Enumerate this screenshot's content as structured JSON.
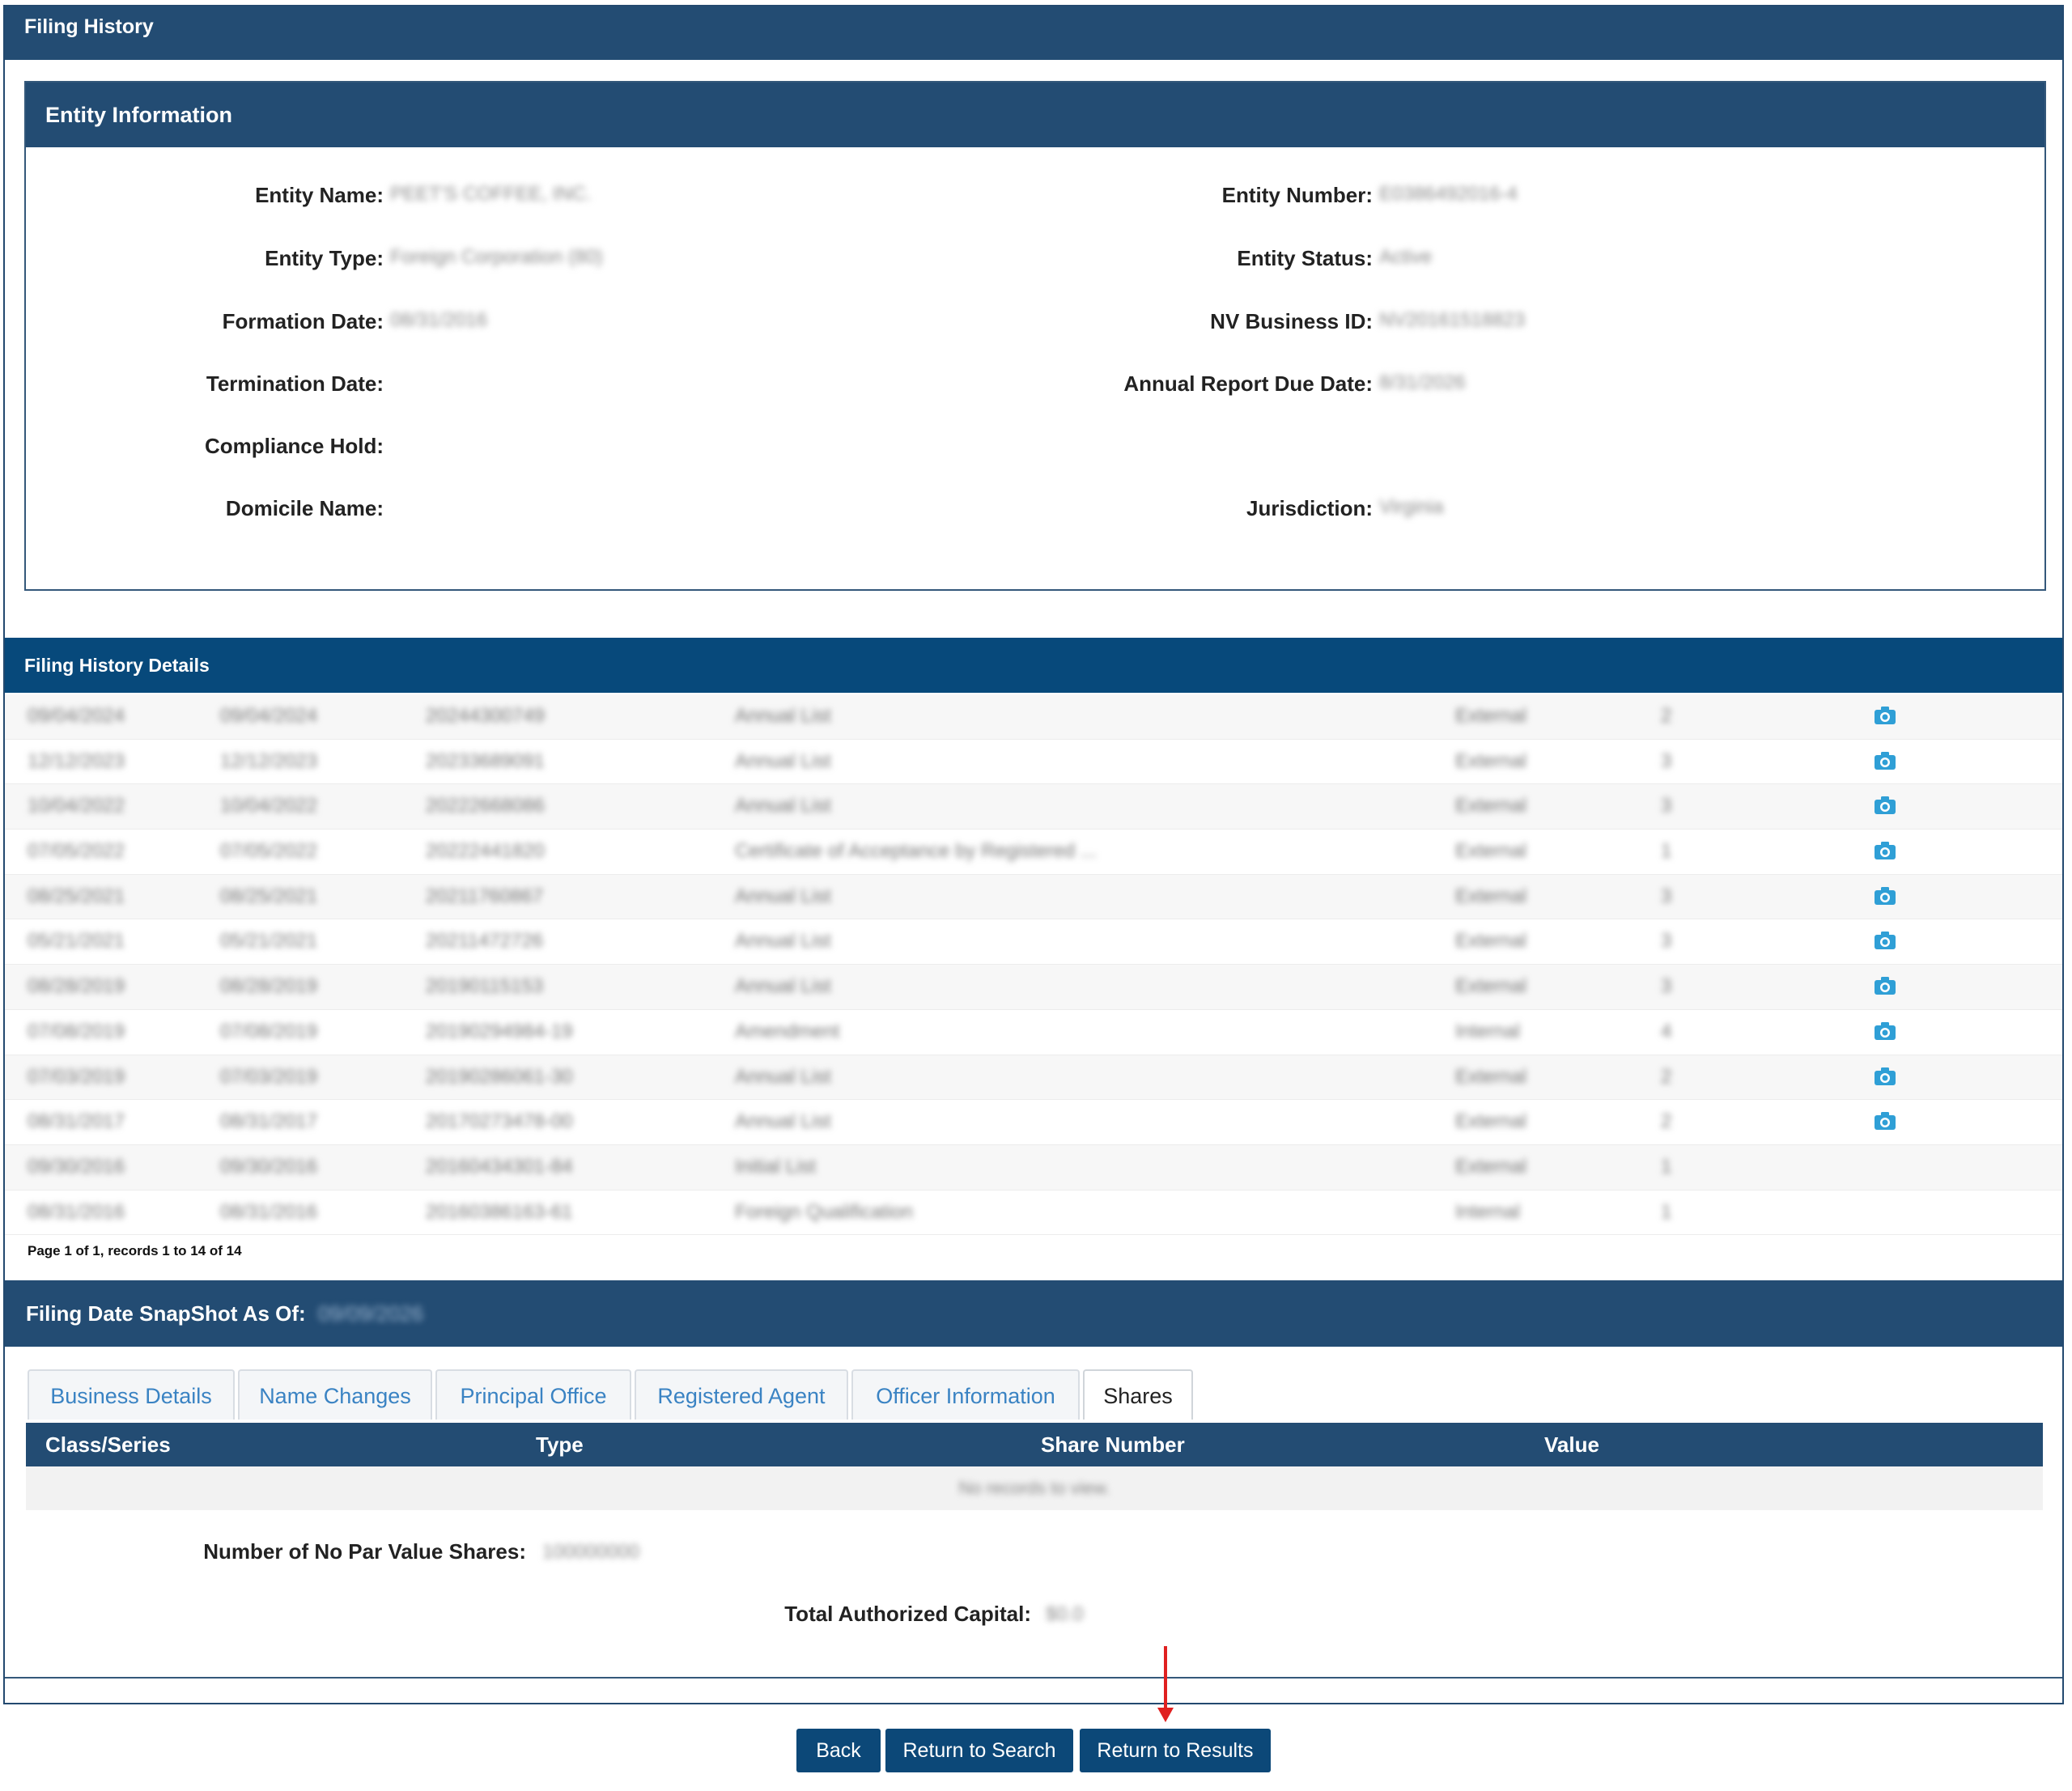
{
  "page_title": "Filing History",
  "entity": {
    "header": "Entity Information",
    "labels": {
      "entity_name": "Entity Name:",
      "entity_type": "Entity Type:",
      "formation_date": "Formation Date:",
      "termination_date": "Termination Date:",
      "compliance_hold": "Compliance Hold:",
      "domicile_name": "Domicile Name:",
      "entity_number": "Entity Number:",
      "entity_status": "Entity Status:",
      "nv_business_id": "NV Business ID:",
      "annual_report_due": "Annual Report Due Date:",
      "jurisdiction": "Jurisdiction:"
    },
    "values": {
      "entity_name": "PEET'S COFFEE, INC.",
      "entity_type": "Foreign Corporation (80)",
      "formation_date": "08/31/2016",
      "entity_number": "E0386492016-4",
      "entity_status": "Active",
      "nv_business_id": "NV20161518823",
      "annual_report_due": "8/31/2026",
      "jurisdiction": "Virginia"
    }
  },
  "filing_history": {
    "header": "Filing History Details",
    "rows": [
      {
        "filed": "09/04/2024",
        "effective": "09/04/2024",
        "number": "20244300749",
        "type": "Annual List",
        "source": "External",
        "pages": "2",
        "has_image": true
      },
      {
        "filed": "12/12/2023",
        "effective": "12/12/2023",
        "number": "20233689091",
        "type": "Annual List",
        "source": "External",
        "pages": "3",
        "has_image": true
      },
      {
        "filed": "10/04/2022",
        "effective": "10/04/2022",
        "number": "20222668086",
        "type": "Annual List",
        "source": "External",
        "pages": "3",
        "has_image": true
      },
      {
        "filed": "07/05/2022",
        "effective": "07/05/2022",
        "number": "20222441820",
        "type": "Certificate of Acceptance by Registered ...",
        "source": "External",
        "pages": "1",
        "has_image": true
      },
      {
        "filed": "08/25/2021",
        "effective": "08/25/2021",
        "number": "20211760867",
        "type": "Annual List",
        "source": "External",
        "pages": "3",
        "has_image": true
      },
      {
        "filed": "05/21/2021",
        "effective": "05/21/2021",
        "number": "20211472726",
        "type": "Annual List",
        "source": "External",
        "pages": "3",
        "has_image": true
      },
      {
        "filed": "08/28/2019",
        "effective": "08/28/2019",
        "number": "20190115153",
        "type": "Annual List",
        "source": "External",
        "pages": "3",
        "has_image": true
      },
      {
        "filed": "07/08/2019",
        "effective": "07/08/2019",
        "number": "20190294984-19",
        "type": "Amendment",
        "source": "Internal",
        "pages": "4",
        "has_image": true
      },
      {
        "filed": "07/03/2019",
        "effective": "07/03/2019",
        "number": "20190286061-30",
        "type": "Annual List",
        "source": "External",
        "pages": "2",
        "has_image": true
      },
      {
        "filed": "08/31/2017",
        "effective": "08/31/2017",
        "number": "20170273478-00",
        "type": "Annual List",
        "source": "External",
        "pages": "2",
        "has_image": true
      },
      {
        "filed": "09/30/2016",
        "effective": "09/30/2016",
        "number": "20160434301-84",
        "type": "Initial List",
        "source": "External",
        "pages": "1",
        "has_image": false
      },
      {
        "filed": "08/31/2016",
        "effective": "08/31/2016",
        "number": "20160386163-61",
        "type": "Foreign Qualification",
        "source": "Internal",
        "pages": "1",
        "has_image": false
      }
    ],
    "pager": "Page 1 of 1, records 1 to 14 of 14"
  },
  "snapshot": {
    "label": "Filing Date SnapShot As Of:",
    "date": "09/09/2026",
    "tabs": [
      "Business Details",
      "Name Changes",
      "Principal Office",
      "Registered Agent",
      "Officer Information",
      "Shares"
    ],
    "active_tab": "Shares",
    "shares_columns": [
      "Class/Series",
      "Type",
      "Share Number",
      "Value"
    ],
    "empty_message": "No records to view.",
    "no_par_label": "Number of No Par Value Shares:",
    "no_par_value": "100000000",
    "capital_label": "Total Authorized Capital:",
    "capital_value": "$0.0"
  },
  "buttons": {
    "back": "Back",
    "return_search": "Return to Search",
    "return_results": "Return to Results"
  },
  "colors": {
    "header_blue": "#234c73",
    "details_blue": "#07497b",
    "tab_link": "#3a83c3",
    "camera_icon": "#2f9fd6",
    "annotation_arrow": "#e02020"
  }
}
